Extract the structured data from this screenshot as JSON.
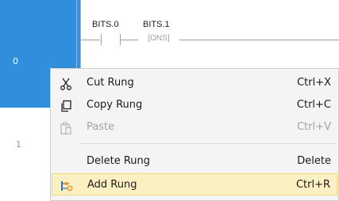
{
  "rungs": [
    {
      "number": "0",
      "selected": true
    },
    {
      "number": "1",
      "selected": false
    }
  ],
  "rung0": {
    "tag_contact": "BITS.0",
    "tag_ons": "BITS.1",
    "ons_text": "[ONS]"
  },
  "context_menu": {
    "items": [
      {
        "icon": "scissors-icon",
        "label": "Cut Rung",
        "shortcut": "Ctrl+X",
        "enabled": true
      },
      {
        "icon": "copy-icon",
        "label": "Copy Rung",
        "shortcut": "Ctrl+C",
        "enabled": true
      },
      {
        "icon": "paste-icon",
        "label": "Paste",
        "shortcut": "Ctrl+V",
        "enabled": false
      },
      {
        "icon": "",
        "label": "Delete Rung",
        "shortcut": "Delete",
        "enabled": true
      },
      {
        "icon": "add-rung-icon",
        "label": "Add Rung",
        "shortcut": "Ctrl+R",
        "enabled": true,
        "highlighted": true
      }
    ]
  },
  "colors": {
    "selection_blue": "#2f8fdd",
    "highlight_bg": "#fbf0c2",
    "highlight_border": "#f3d879"
  }
}
